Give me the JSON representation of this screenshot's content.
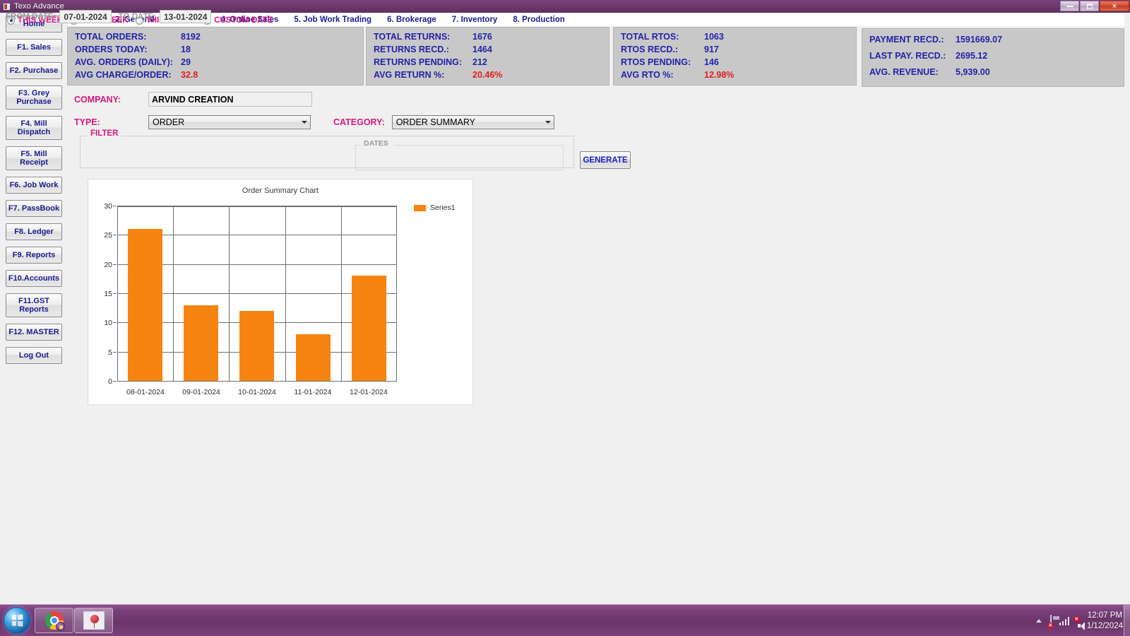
{
  "window": {
    "title": "Texo Advance",
    "icon": "form-icon",
    "buttons": {
      "minimize": "minimize-button",
      "maximize": "maximize-button",
      "close": "close-button"
    }
  },
  "sidebar": {
    "items": [
      {
        "label": "Home"
      },
      {
        "label": "F1. Sales"
      },
      {
        "label": "F2. Purchase"
      },
      {
        "label": "F3. Grey Purchase"
      },
      {
        "label": "F4. Mill Dispatch"
      },
      {
        "label": "F5. Mill Receipt"
      },
      {
        "label": "F6. Job Work"
      },
      {
        "label": "F7. PassBook"
      },
      {
        "label": "F8. Ledger"
      },
      {
        "label": "F9. Reports"
      },
      {
        "label": "F10.Accounts"
      },
      {
        "label": "F11.GST Reports"
      },
      {
        "label": "F12. MASTER"
      },
      {
        "label": "Log Out"
      }
    ]
  },
  "menu": {
    "items": [
      {
        "label": "1. Bills"
      },
      {
        "label": "2. General"
      },
      {
        "label": "3. Master"
      },
      {
        "label": "4. Online Sales"
      },
      {
        "label": "5. Job Work Trading"
      },
      {
        "label": "6. Brokerage"
      },
      {
        "label": "7. Inventory"
      },
      {
        "label": "8. Production"
      }
    ]
  },
  "stats": {
    "panels": [
      {
        "rows": [
          {
            "label": "TOTAL ORDERS:",
            "value": "8192",
            "alert": false
          },
          {
            "label": "ORDERS TODAY:",
            "value": "18",
            "alert": false
          },
          {
            "label": "AVG. ORDERS (DAILY):",
            "value": "29",
            "alert": false
          },
          {
            "label": "AVG CHARGE/ORDER:",
            "value": "32.8",
            "alert": true
          }
        ]
      },
      {
        "rows": [
          {
            "label": "TOTAL RETURNS:",
            "value": "1676",
            "alert": false
          },
          {
            "label": "RETURNS RECD.:",
            "value": "1464",
            "alert": false
          },
          {
            "label": "RETURNS PENDING:",
            "value": "212",
            "alert": false
          },
          {
            "label": "AVG RETURN %:",
            "value": "20.46%",
            "alert": true
          }
        ]
      },
      {
        "rows": [
          {
            "label": "TOTAL RTOS:",
            "value": "1063",
            "alert": false
          },
          {
            "label": "RTOS RECD.:",
            "value": "917",
            "alert": false
          },
          {
            "label": "RTOS PENDING:",
            "value": "146",
            "alert": false
          },
          {
            "label": "AVG RTO %:",
            "value": "12.98%",
            "alert": true
          }
        ]
      },
      {
        "rows": [
          {
            "label": "PAYMENT RECD.:",
            "value": "1591669.07",
            "alert": false
          },
          {
            "label": "LAST PAY. RECD.:",
            "value": "2695.12",
            "alert": false
          },
          {
            "label": "AVG. REVENUE:",
            "value": "5,939.00",
            "alert": false
          }
        ]
      }
    ]
  },
  "form": {
    "company_label": "COMPANY:",
    "company_value": "ARVIND CREATION",
    "type_label": "TYPE:",
    "type_value": "ORDER",
    "category_label": "CATEGORY:",
    "category_value": "ORDER SUMMARY",
    "filter_legend": "FILTER",
    "filter_options": [
      {
        "label": "THIS WEEK",
        "selected": true
      },
      {
        "label": "LAST WEEK",
        "selected": false
      },
      {
        "label": "THIS MONTH",
        "selected": false
      },
      {
        "label": "CUSTOM DATE",
        "selected": false
      }
    ],
    "dates_legend": "DATES",
    "from_date_label": "FROM DATE:",
    "from_date_value": "07-01-2024",
    "to_date_label": "TO DATE:",
    "to_date_value": "13-01-2024",
    "generate_label": "GENERATE"
  },
  "colors": {
    "bar": "#f58410",
    "stat_text": "#2222aa",
    "stat_alert": "#e02020",
    "form_label": "#d6177f",
    "button_text": "#1b1b8f"
  },
  "chart_data": {
    "type": "bar",
    "title": "Order Summary Chart",
    "categories": [
      "08-01-2024",
      "09-01-2024",
      "10-01-2024",
      "11-01-2024",
      "12-01-2024"
    ],
    "values": [
      26,
      13,
      12,
      8,
      18
    ],
    "series": [
      {
        "name": "Series1",
        "values": [
          26,
          13,
          12,
          8,
          18
        ],
        "color": "#f58410"
      }
    ],
    "xlabel": "",
    "ylabel": "",
    "ylim": [
      0,
      30
    ],
    "yticks": [
      0,
      5,
      10,
      15,
      20,
      25,
      30
    ],
    "grid": true,
    "legend_position": "right",
    "legend_entries": [
      "Series1"
    ]
  },
  "taskbar": {
    "start_label": "start-orb",
    "apps": [
      {
        "name": "chrome-taskbar-button"
      },
      {
        "name": "app-taskbar-button"
      }
    ],
    "tray": [
      {
        "name": "action-center-flag-icon"
      },
      {
        "name": "network-signal-icon"
      },
      {
        "name": "volume-speaker-icon"
      }
    ],
    "clock_time": "12:07 PM",
    "clock_date": "1/12/2024"
  }
}
